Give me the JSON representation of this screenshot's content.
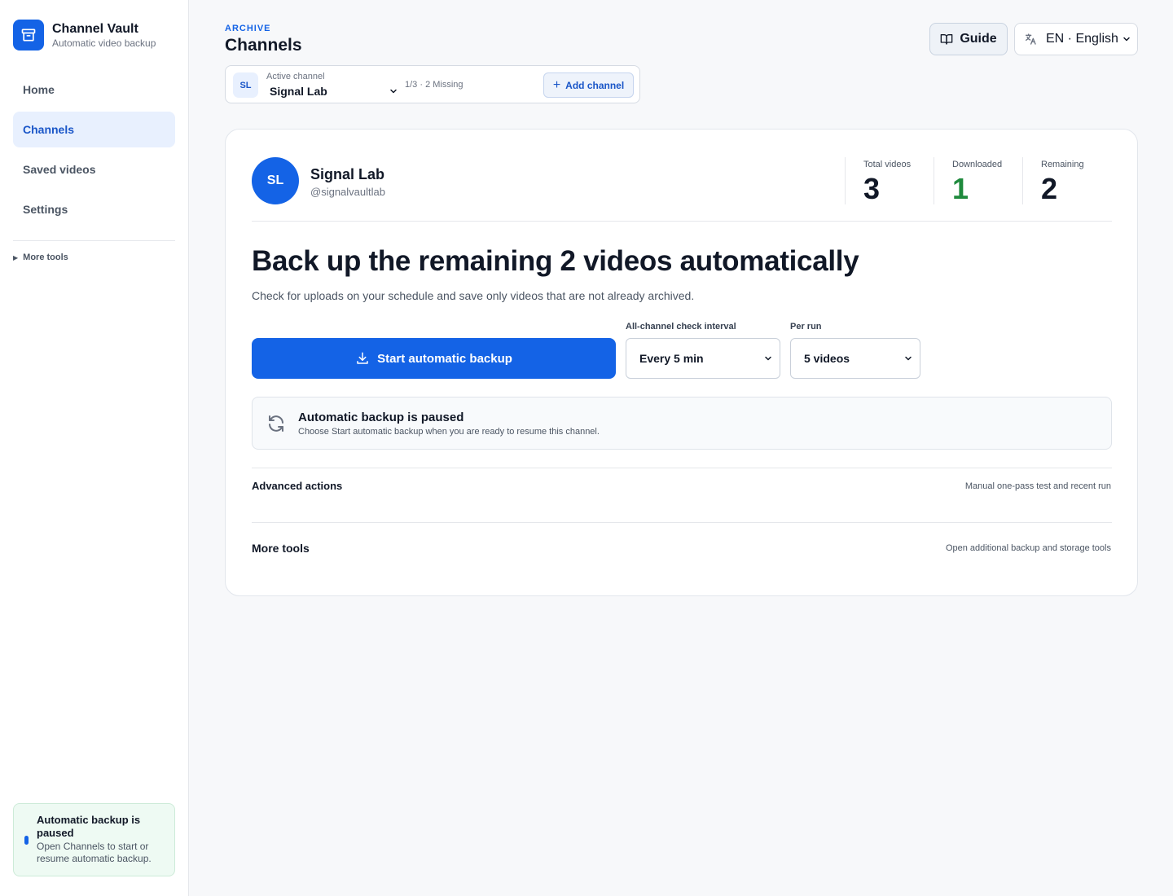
{
  "app": {
    "name": "Channel Vault",
    "tagline": "Automatic video backup"
  },
  "sidebar": {
    "nav": [
      {
        "label": "Home",
        "active": false
      },
      {
        "label": "Channels",
        "active": true
      },
      {
        "label": "Saved videos",
        "active": false
      },
      {
        "label": "Settings",
        "active": false
      }
    ],
    "more_tools": "More tools",
    "status": {
      "title": "Automatic backup is paused",
      "text": "Open Channels to start or resume automatic backup."
    }
  },
  "header": {
    "eyebrow": "ARCHIVE",
    "title": "Channels",
    "guide_label": "Guide",
    "language_label": "EN · English"
  },
  "channel_bar": {
    "avatar_initials": "SL",
    "label": "Active channel",
    "selected": "Signal Lab",
    "count": "1/3 · 2 Missing",
    "add_label": "Add channel"
  },
  "channel": {
    "initials": "SL",
    "name": "Signal Lab",
    "handle": "@signalvaultlab",
    "stats": [
      {
        "label": "Total videos",
        "value": "3"
      },
      {
        "label": "Downloaded",
        "value": "1"
      },
      {
        "label": "Remaining",
        "value": "2"
      }
    ]
  },
  "backup": {
    "headline": "Back up the remaining 2 videos automatically",
    "subline": "Check for uploads on your schedule and save only videos that are not already archived.",
    "start_label": "Start automatic backup",
    "interval_label": "All-channel check interval",
    "interval_value": "Every 5 min",
    "per_run_label": "Per run",
    "per_run_value": "5 videos",
    "paused_title": "Automatic backup is paused",
    "paused_text": "Choose Start automatic backup when you are ready to resume this channel."
  },
  "sections": {
    "advanced_title": "Advanced actions",
    "advanced_hint": "Manual one-pass test and recent run",
    "more_title": "More tools",
    "more_hint": "Open additional backup and storage tools"
  },
  "colors": {
    "accent": "#1463e6",
    "downloaded": "#1f8a3d",
    "status_bg": "#eefaf3"
  },
  "icons": [
    "archive-box-icon",
    "triangle-right-icon",
    "book-icon",
    "translate-icon",
    "chevron-down-icon",
    "plus-icon",
    "download-icon",
    "refresh-icon"
  ]
}
